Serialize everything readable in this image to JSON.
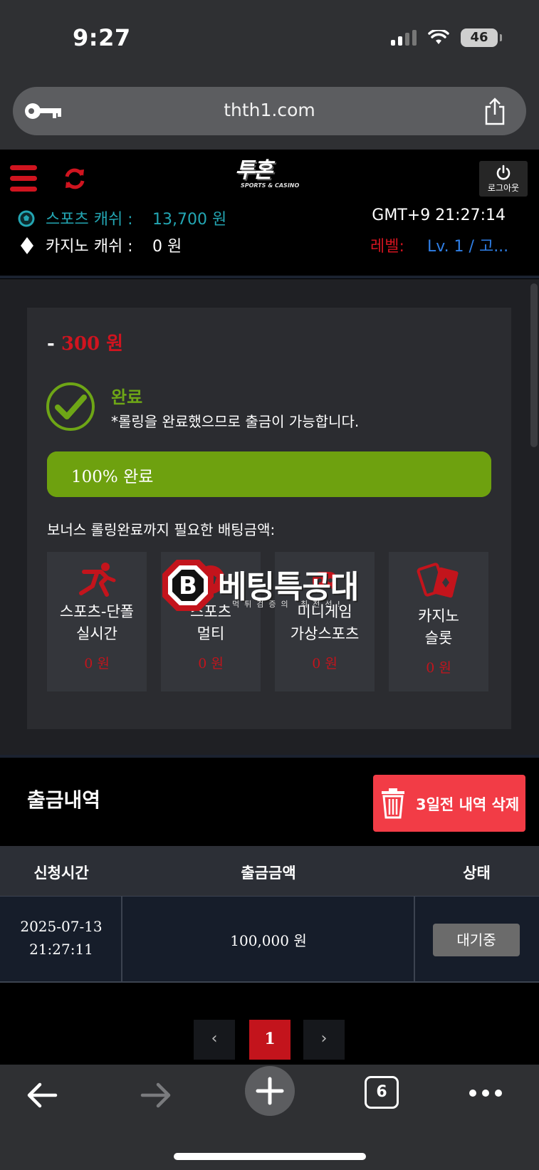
{
  "status_bar": {
    "time": "9:27",
    "battery": "46"
  },
  "browser": {
    "url": "thth1.com",
    "tab_count": "6"
  },
  "header": {
    "logo_text": "투혼",
    "logo_sub": "SPORTS & CASINO",
    "logout_label": "로그아웃"
  },
  "account": {
    "sports_cash_label": "스포츠 캐쉬 :",
    "sports_cash_value": "13,700 원",
    "casino_cash_label": "카지노 캐쉬 :",
    "casino_cash_value": "0 원",
    "clock": "GMT+9 21:27:14",
    "level_label": "레벨:",
    "level_value": "Lv. 1 / 고..."
  },
  "rolling": {
    "amount_prefix": "-",
    "amount": "300 원",
    "status_title": "완료",
    "status_desc": "*롤링을 완료했으므로 출금이 가능합니다.",
    "progress_percent": 100,
    "progress_label": "100% 완료",
    "bonus_label": "보너스 롤링완료까지 필요한 배팅금액:",
    "cards": [
      {
        "line1": "스포츠-단폴",
        "line2": "실시간",
        "amount": "0 원",
        "icon": "running-man-icon"
      },
      {
        "line1": "스포츠",
        "line2": "멀티",
        "amount": "0 원",
        "icon": "soccer-icon"
      },
      {
        "line1": "미니게임",
        "line2": "가상스포츠",
        "amount": "0 원",
        "icon": "minigame-icon"
      },
      {
        "line1": "카지노",
        "line2": "슬롯",
        "amount": "0 원",
        "icon": "cards-icon"
      }
    ]
  },
  "watermark": {
    "title": "베팅특공대",
    "subtitle": "먹튀검증의 최전선!"
  },
  "history": {
    "title": "출금내역",
    "delete_button": "3일전 내역 삭제",
    "columns": [
      "신청시간",
      "출금금액",
      "상태"
    ],
    "rows": [
      {
        "date": "2025-07-13",
        "time": "21:27:11",
        "amount": "100,000 원",
        "status": "대기중"
      }
    ]
  },
  "pagination": {
    "prev": "‹",
    "current": "1",
    "next": "›"
  },
  "colors": {
    "accent_red": "#d0141f",
    "success_green": "#6ea10f",
    "cash_teal": "#23a6b3",
    "level_blue": "#2f7fe6",
    "delete_red": "#f23c46"
  }
}
